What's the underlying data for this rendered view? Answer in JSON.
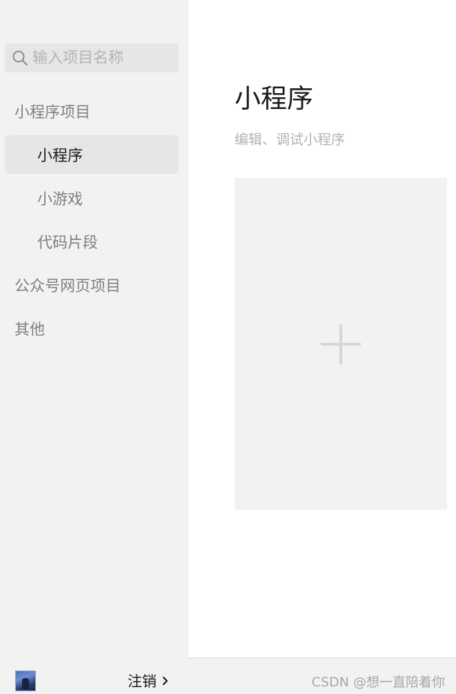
{
  "sidebar": {
    "search": {
      "placeholder": "输入项目名称",
      "icon": "search-icon"
    },
    "nav": {
      "miniprogram_project": "小程序项目",
      "miniprogram": "小程序",
      "minigame": "小游戏",
      "code_snippet": "代码片段",
      "official_account_web": "公众号网页项目",
      "other": "其他"
    },
    "footer": {
      "logout_label": "注销",
      "chevron_icon": "chevron-right-icon",
      "avatar": "avatar"
    }
  },
  "main": {
    "title": "小程序",
    "subtitle": "编辑、调试小程序",
    "create_card_icon": "plus-icon"
  },
  "watermark": "CSDN @想一直陪着你",
  "colors": {
    "sidebar_bg": "#f2f2f2",
    "active_item_bg": "#e6e6e6",
    "card_bg": "#f2f2f2",
    "muted_text": "#7f7f7f",
    "primary_text": "#1a1a1a"
  }
}
